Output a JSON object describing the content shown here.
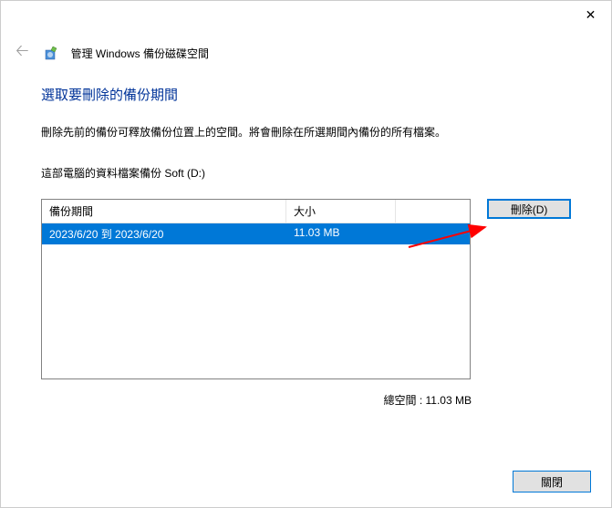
{
  "titlebar": {
    "close_glyph": "✕"
  },
  "header": {
    "back_glyph": "🡠",
    "title": "管理 Windows 備份磁碟空間"
  },
  "heading": "選取要刪除的備份期間",
  "description": "刪除先前的備份可釋放備份位置上的空間。將會刪除在所選期間內備份的所有檔案。",
  "subdescription": "這部電腦的資料檔案備份 Soft (D:)",
  "list": {
    "columns": {
      "period": "備份期間",
      "size": "大小"
    },
    "rows": [
      {
        "period": "2023/6/20 到 2023/6/20",
        "size": "11.03 MB"
      }
    ]
  },
  "delete_label": "刪除(D)",
  "total_label": "總空間 : 11.03 MB",
  "close_label": "關閉"
}
